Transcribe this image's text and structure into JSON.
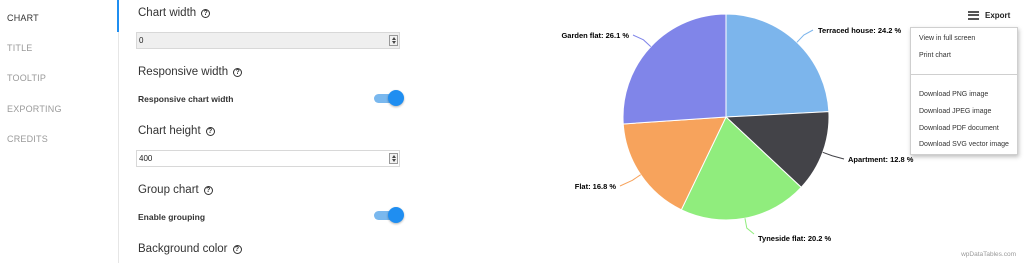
{
  "nav": {
    "items": [
      {
        "label": "CHART",
        "active": true
      },
      {
        "label": "TITLE",
        "active": false
      },
      {
        "label": "TOOLTIP",
        "active": false
      },
      {
        "label": "EXPORTING",
        "active": false
      },
      {
        "label": "CREDITS",
        "active": false
      }
    ]
  },
  "settings": {
    "chart_width": {
      "title": "Chart width",
      "value": "0"
    },
    "responsive_width": {
      "title": "Responsive width",
      "toggle_label": "Responsive chart width",
      "enabled": true
    },
    "chart_height": {
      "title": "Chart height",
      "value": "400"
    },
    "group_chart": {
      "title": "Group chart",
      "toggle_label": "Enable grouping",
      "enabled": true
    },
    "background_color": {
      "title": "Background color"
    }
  },
  "export": {
    "button_label": "Export",
    "menu": {
      "view_full_screen": "View in full screen",
      "print_chart": "Print chart",
      "download_png": "Download PNG image",
      "download_jpeg": "Download JPEG image",
      "download_pdf": "Download PDF document",
      "download_svg": "Download SVG vector image"
    }
  },
  "credit": "wpDataTables.com",
  "chart_data": {
    "type": "pie",
    "slices": [
      {
        "name": "Terraced house",
        "value": 24.2,
        "label": "Terraced house: 24.2 %",
        "color": "#7cb5ec"
      },
      {
        "name": "Apartment",
        "value": 12.8,
        "label": "Apartment: 12.8 %",
        "color": "#434348"
      },
      {
        "name": "Tyneside flat",
        "value": 20.2,
        "label": "Tyneside flat: 20.2 %",
        "color": "#90ed7d"
      },
      {
        "name": "Flat",
        "value": 16.8,
        "label": "Flat: 16.8 %",
        "color": "#f7a35c"
      },
      {
        "name": "Garden flat",
        "value": 26.1,
        "label": "Garden flat: 26.1 %",
        "color": "#8085e9"
      }
    ]
  }
}
